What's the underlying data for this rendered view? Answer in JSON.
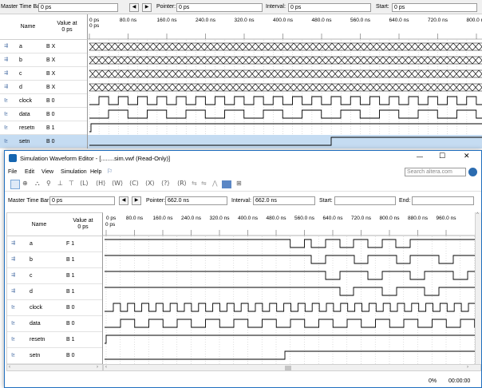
{
  "back": {
    "toolbar": {
      "master_label": "Master Time Bar:",
      "master_value": "0 ps",
      "prev_btn": "◀",
      "next_btn": "▶",
      "pointer_label": "Pointer:",
      "pointer_value": "0 ps",
      "interval_label": "Interval:",
      "interval_value": "0 ps",
      "start_label": "Start:",
      "start_value": "0 ps"
    },
    "columns": {
      "name": "Name",
      "value": "Value at\n0 ps"
    },
    "scale_label": "0 ps",
    "ticks": [
      "0 ps",
      "80.0 ns",
      "160.0 ns",
      "240.0 ns",
      "320.0 ns",
      "400.0 ns",
      "480.0 ns",
      "560.0 ns",
      "640.0 ns",
      "720.0 ns",
      "800.0 ns"
    ],
    "signals": [
      {
        "icon": "bus-input-icon",
        "name": "a",
        "value": "B X"
      },
      {
        "icon": "bus-input-icon",
        "name": "b",
        "value": "B X"
      },
      {
        "icon": "bus-input-icon",
        "name": "c",
        "value": "B X"
      },
      {
        "icon": "bus-input-icon",
        "name": "d",
        "value": "B X"
      },
      {
        "icon": "input-pin-icon",
        "name": "clock",
        "value": "B 0"
      },
      {
        "icon": "input-pin-icon",
        "name": "data",
        "value": "B 0"
      },
      {
        "icon": "input-pin-icon",
        "name": "resetn",
        "value": "B 1"
      },
      {
        "icon": "input-pin-icon",
        "name": "setn",
        "value": "B 0"
      }
    ],
    "selected_row": "setn"
  },
  "front": {
    "title": "Simulation Waveform Editor - [........sim.vwf (Read-Only)]",
    "window_controls": {
      "minimize": "—",
      "maximize": "☐",
      "close": "✕"
    },
    "menu": [
      "File",
      "Edit",
      "View",
      "Simulation",
      "Help"
    ],
    "search_placeholder": "Search altera.com",
    "toolbar": {
      "master_label": "Master Time Bar:",
      "master_value": "0 ps",
      "prev_btn": "◀",
      "next_btn": "▶",
      "pointer_label": "Pointer:",
      "pointer_value": "662.0 ns",
      "interval_label": "Interval:",
      "interval_value": "662.0 ns",
      "start_label": "Start:",
      "start_value": "",
      "end_label": "End:",
      "end_value": ""
    },
    "columns": {
      "name": "Name",
      "value": "Value at\n0 ps"
    },
    "scale_label": "0 ps",
    "ticks": [
      "0 ps",
      "80.0 ns",
      "160.0 ns",
      "240.0 ns",
      "320.0 ns",
      "400.0 ns",
      "480.0 ns",
      "560.0 ns",
      "640.0 ns",
      "720.0 ns",
      "800.0 ns",
      "880.0 ns",
      "960.0 ns"
    ],
    "signals": [
      {
        "icon": "output-pin-icon",
        "name": "a",
        "value": "F 1"
      },
      {
        "icon": "output-pin-icon",
        "name": "b",
        "value": "B 1"
      },
      {
        "icon": "output-pin-icon",
        "name": "c",
        "value": "B 1"
      },
      {
        "icon": "output-pin-icon",
        "name": "d",
        "value": "B 1"
      },
      {
        "icon": "input-pin-icon",
        "name": "clock",
        "value": "B 0"
      },
      {
        "icon": "input-pin-icon",
        "name": "data",
        "value": "B 0"
      },
      {
        "icon": "input-pin-icon",
        "name": "resetn",
        "value": "B 1"
      },
      {
        "icon": "input-pin-icon",
        "name": "setn",
        "value": "B 0"
      }
    ],
    "status": {
      "progress": "0%",
      "time": "00:00:00"
    }
  },
  "colors": {
    "selected_row": "#c5dcf2",
    "wave": "#000000",
    "grid": "#c8c8c8",
    "window_border": "#1f6fbf"
  }
}
